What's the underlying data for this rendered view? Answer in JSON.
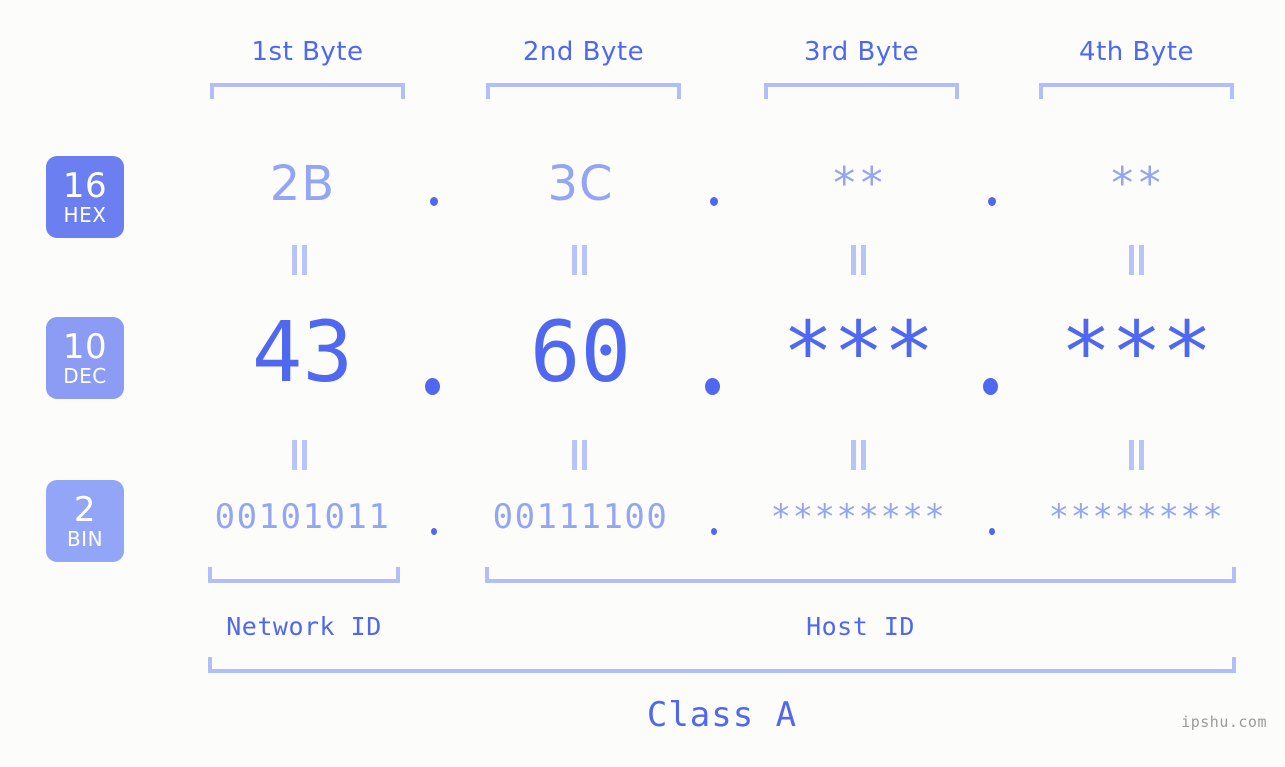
{
  "background_color": "#fcfdfa",
  "accent_strong": "#5068ef",
  "accent_light": "#94a6f3",
  "accent_pale": "#b3bdf7",
  "headers": {
    "byte1": "1st Byte",
    "byte2": "2nd Byte",
    "byte3": "3rd Byte",
    "byte4": "4th Byte"
  },
  "bases": [
    {
      "number": "16",
      "name": "HEX",
      "color": "#6c7ff0"
    },
    {
      "number": "10",
      "name": "DEC",
      "color": "#8c9cf4"
    },
    {
      "number": "2",
      "name": "BIN",
      "color": "#93a5f6"
    }
  ],
  "rows": {
    "hex": {
      "base_number": "16",
      "base_name": "HEX",
      "values": [
        "2B",
        "3C",
        "**",
        "**"
      ],
      "separator": "."
    },
    "dec": {
      "base_number": "10",
      "base_name": "DEC",
      "values": [
        "43",
        "60",
        "***",
        "***"
      ],
      "separator": "."
    },
    "bin": {
      "base_number": "2",
      "base_name": "BIN",
      "values": [
        "00101011",
        "00111100",
        "********",
        "********"
      ],
      "separator": "."
    }
  },
  "connectors": {
    "equals": "||"
  },
  "footer": {
    "network_id": "Network ID",
    "host_id": "Host ID",
    "class": "Class A",
    "watermark": "ipshu.com"
  }
}
